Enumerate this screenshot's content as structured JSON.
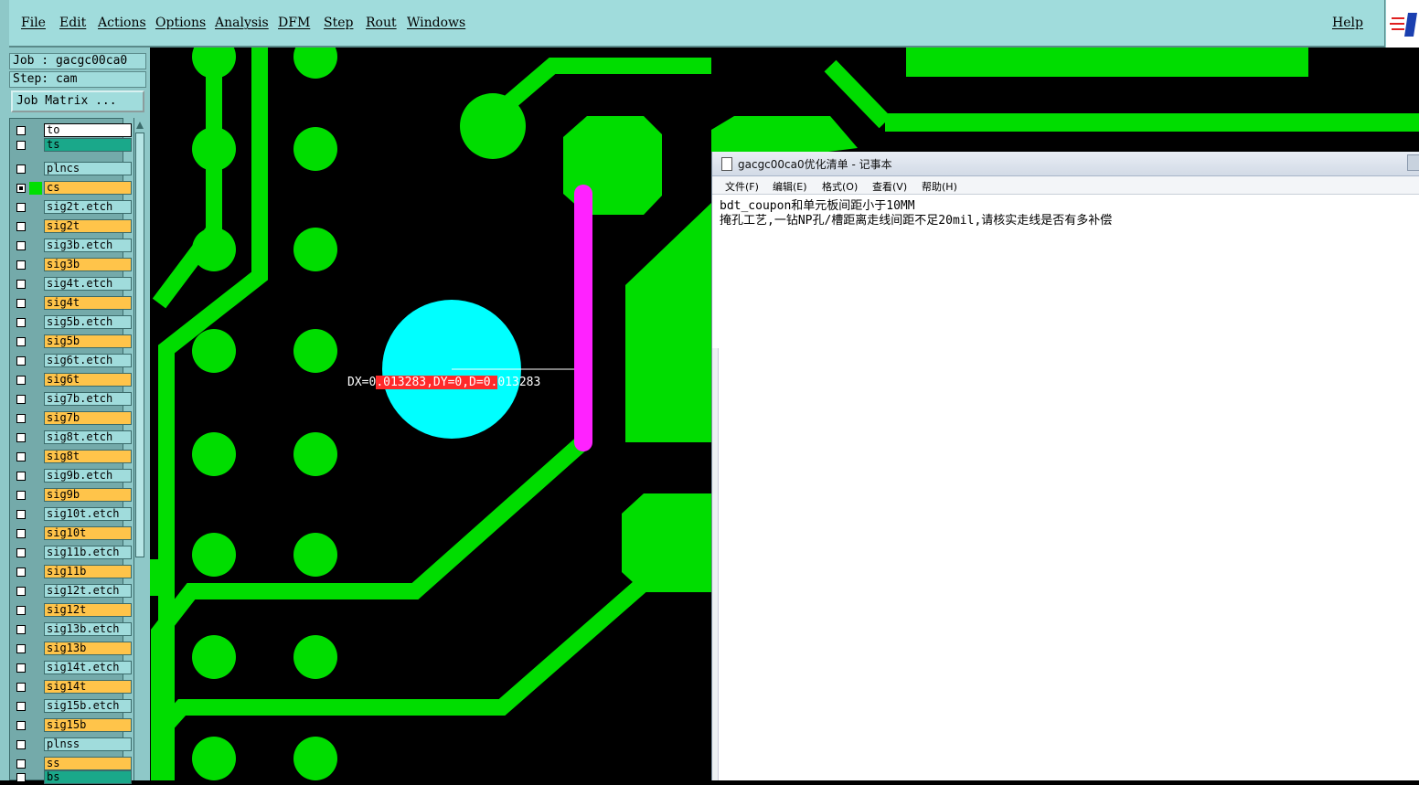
{
  "menubar": {
    "items": [
      "File",
      "Edit",
      "Actions",
      "Options",
      "Analysis",
      "DFM",
      "Step",
      "Rout",
      "Windows"
    ],
    "help": "Help"
  },
  "job": {
    "job_line": "Job : gacgc00ca0",
    "step_line": "Step: cam",
    "matrix_button": "Job Matrix ..."
  },
  "layers": [
    {
      "name": "to",
      "color": "#ffffff",
      "style": "white",
      "checked": false
    },
    {
      "name": "ts",
      "color": "#1aa88a",
      "style": "dark",
      "checked": false
    },
    {
      "name": "plncs",
      "color": "",
      "style": "teal",
      "checked": false
    },
    {
      "name": "cs",
      "color": "#00e000",
      "style": "orange",
      "checked": true,
      "tag": "⊞"
    },
    {
      "name": "sig2t.etch",
      "color": "",
      "style": "teal",
      "checked": false
    },
    {
      "name": "sig2t",
      "color": "",
      "style": "orange",
      "checked": false
    },
    {
      "name": "sig3b.etch",
      "color": "",
      "style": "teal",
      "checked": false
    },
    {
      "name": "sig3b",
      "color": "",
      "style": "orange",
      "checked": false
    },
    {
      "name": "sig4t.etch",
      "color": "",
      "style": "teal",
      "checked": false
    },
    {
      "name": "sig4t",
      "color": "",
      "style": "orange",
      "checked": false
    },
    {
      "name": "sig5b.etch",
      "color": "",
      "style": "teal",
      "checked": false
    },
    {
      "name": "sig5b",
      "color": "",
      "style": "orange",
      "checked": false
    },
    {
      "name": "sig6t.etch",
      "color": "",
      "style": "teal",
      "checked": false
    },
    {
      "name": "sig6t",
      "color": "",
      "style": "orange",
      "checked": false
    },
    {
      "name": "sig7b.etch",
      "color": "",
      "style": "teal",
      "checked": false
    },
    {
      "name": "sig7b",
      "color": "",
      "style": "orange",
      "checked": false
    },
    {
      "name": "sig8t.etch",
      "color": "",
      "style": "teal",
      "checked": false
    },
    {
      "name": "sig8t",
      "color": "",
      "style": "orange",
      "checked": false
    },
    {
      "name": "sig9b.etch",
      "color": "",
      "style": "teal",
      "checked": false
    },
    {
      "name": "sig9b",
      "color": "",
      "style": "orange",
      "checked": false
    },
    {
      "name": "sig10t.etch",
      "color": "",
      "style": "teal",
      "checked": false
    },
    {
      "name": "sig10t",
      "color": "",
      "style": "orange",
      "checked": false
    },
    {
      "name": "sig11b.etch",
      "color": "",
      "style": "teal",
      "checked": false
    },
    {
      "name": "sig11b",
      "color": "",
      "style": "orange",
      "checked": false
    },
    {
      "name": "sig12t.etch",
      "color": "",
      "style": "teal",
      "checked": false
    },
    {
      "name": "sig12t",
      "color": "",
      "style": "orange",
      "checked": false
    },
    {
      "name": "sig13b.etch",
      "color": "",
      "style": "teal",
      "checked": false
    },
    {
      "name": "sig13b",
      "color": "",
      "style": "orange",
      "checked": false
    },
    {
      "name": "sig14t.etch",
      "color": "",
      "style": "teal",
      "checked": false
    },
    {
      "name": "sig14t",
      "color": "",
      "style": "orange",
      "checked": false
    },
    {
      "name": "sig15b.etch",
      "color": "",
      "style": "teal",
      "checked": false
    },
    {
      "name": "sig15b",
      "color": "",
      "style": "orange",
      "checked": false
    },
    {
      "name": "plnss",
      "color": "",
      "style": "teal",
      "checked": false
    },
    {
      "name": "ss",
      "color": "",
      "style": "orange",
      "checked": false
    },
    {
      "name": "bs",
      "color": "",
      "style": "dark",
      "checked": false
    }
  ],
  "measure": {
    "prefix": "DX=0",
    "highlight": ".013283,DY=0,D=0.",
    "suffix": "013283"
  },
  "colors": {
    "copper": "#00dd00",
    "drill": "#00ffff",
    "rout": "#ff22ff",
    "panel": "#a0dcdc"
  },
  "notepad": {
    "title": "gacgc00ca0优化清单 - 记事本",
    "menus": [
      "文件(F)",
      "编辑(E)",
      "格式(O)",
      "查看(V)",
      "帮助(H)"
    ],
    "lines": [
      "bdt_coupon和单元板间距小于10MM",
      "掩孔工艺,一钻NP孔/槽距离走线间距不足20mil,请核实走线是否有多补偿"
    ]
  }
}
